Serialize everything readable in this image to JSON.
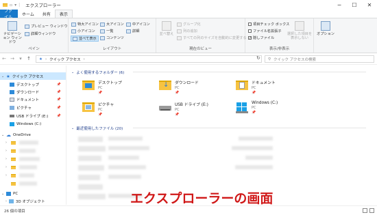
{
  "window": {
    "title": "エクスプローラー",
    "min": "─",
    "max": "☐",
    "close": "✕"
  },
  "tabs": [
    "ファイル",
    "ホーム",
    "共有",
    "表示"
  ],
  "ribbon": {
    "pane": {
      "nav_pane": "ナビゲーション ウィンドウ",
      "preview": "プレビュー ウィンドウ",
      "details": "詳細ウィンドウ",
      "group": "ペイン"
    },
    "layout": {
      "xlarge": "特大アイコン",
      "large": "大アイコン",
      "medium": "中アイコン",
      "small": "小アイコン",
      "list": "一覧",
      "detail": "詳細",
      "tiles": "並べて表示",
      "content": "コンテンツ",
      "group": "レイアウト"
    },
    "current": {
      "sort": "並べ替え",
      "groupby": "グループ化",
      "addcol": "列の追加",
      "fit": "すべての列のサイズを自動的に変更する",
      "group": "現在のビュー"
    },
    "showhide": {
      "checkboxes": "項目チェック ボックス",
      "ext": "ファイル名拡張子",
      "hidden": "隠しファイル",
      "hide_sel": "選択した項目を表示しない",
      "group": "表示/非表示"
    },
    "options": "オプション"
  },
  "address": {
    "path": "クイック アクセス",
    "search_placeholder": "クイック アクセスの検索"
  },
  "nav": {
    "quick": "クイック アクセス",
    "items": [
      "デスクトップ",
      "ダウンロード",
      "ドキュメント",
      "ピクチャ",
      "USB ドライブ (E:)",
      "Windows (C:)"
    ],
    "onedrive": "OneDrive",
    "pc": "PC",
    "obj3d": "3D オブジェクト"
  },
  "content": {
    "frequent_header": "よく使用するフォルダー (6)",
    "recent_header": "最近使用したファイル (20)",
    "tiles": [
      {
        "name": "デスクトップ",
        "sub": "PC"
      },
      {
        "name": "ダウンロード",
        "sub": "PC"
      },
      {
        "name": "ドキュメント",
        "sub": "PC"
      },
      {
        "name": "ピクチャ",
        "sub": "PC"
      },
      {
        "name": "USB ドライブ (E:)",
        "sub": "PC"
      },
      {
        "name": "Windows (C:)",
        "sub": "PC"
      }
    ]
  },
  "status": {
    "count": "26 個の項目"
  },
  "caption": "エクスプローラーの画面",
  "colors": {
    "accent": "#1979ca",
    "caption": "#d01818",
    "folder": "#f6c342"
  }
}
